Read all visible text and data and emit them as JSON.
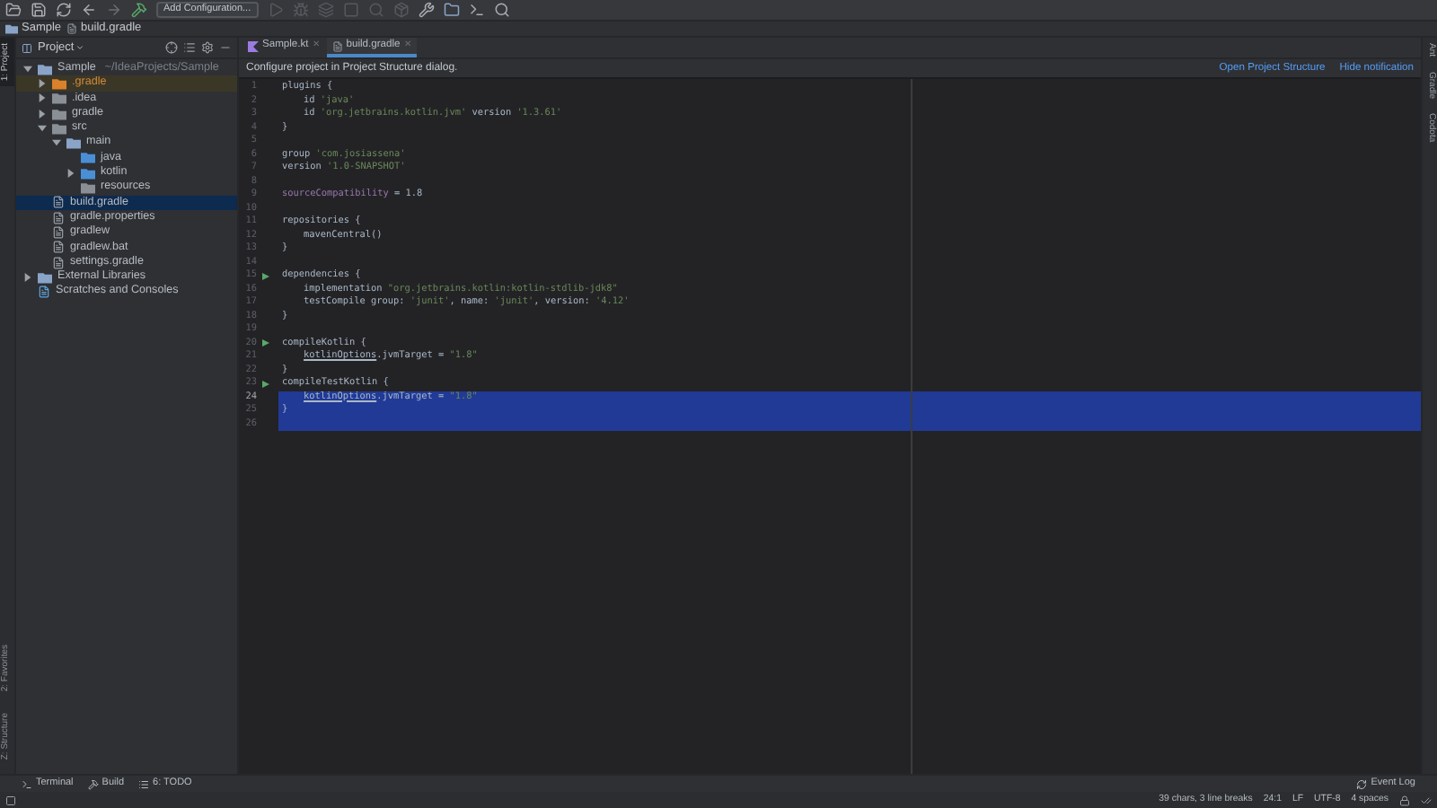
{
  "toolbar": {
    "configuration": "Add Configuration..."
  },
  "breadcrumb": [
    "Sample",
    "build.gradle"
  ],
  "left_stripe": {
    "top": [
      {
        "label": "1: Project",
        "selected": true
      }
    ],
    "bottom": [
      {
        "label": "2: Favorites",
        "selected": false
      },
      {
        "label": "Z: Structure",
        "selected": false
      }
    ]
  },
  "project_panel": {
    "title": "Project",
    "tree": [
      {
        "label": "Sample",
        "hint": "~/IdeaProjects/Sample",
        "kind": "module",
        "expanded": true,
        "selected": false,
        "children": [
          {
            "label": ".gradle",
            "kind": "excluded",
            "expanded": false,
            "selected": false
          },
          {
            "label": ".idea",
            "kind": "folder",
            "expanded": false,
            "selected": false
          },
          {
            "label": "gradle",
            "kind": "folder",
            "expanded": false,
            "selected": false
          },
          {
            "label": "src",
            "kind": "folder",
            "expanded": true,
            "selected": false,
            "children": [
              {
                "label": "main",
                "kind": "module",
                "expanded": true,
                "selected": false,
                "children": [
                  {
                    "label": "java",
                    "kind": "source",
                    "selected": false
                  },
                  {
                    "label": "kotlin",
                    "kind": "source",
                    "expanded": false,
                    "selected": false
                  },
                  {
                    "label": "resources",
                    "kind": "resources",
                    "selected": false
                  }
                ]
              }
            ]
          },
          {
            "label": "build.gradle",
            "kind": "gradle",
            "selected": true
          },
          {
            "label": "gradle.properties",
            "kind": "properties",
            "selected": false
          },
          {
            "label": "gradlew",
            "kind": "file",
            "selected": false
          },
          {
            "label": "gradlew.bat",
            "kind": "file",
            "selected": false
          },
          {
            "label": "settings.gradle",
            "kind": "gradle",
            "selected": false
          }
        ]
      },
      {
        "label": "External Libraries",
        "kind": "library",
        "expanded": false,
        "selected": false
      },
      {
        "label": "Scratches and Consoles",
        "kind": "scratch",
        "selected": false
      }
    ]
  },
  "tabs": [
    {
      "label": "Sample.kt",
      "kind": "kotlin",
      "selected": false,
      "close": "✕"
    },
    {
      "label": "build.gradle",
      "kind": "gradle",
      "selected": true,
      "close": "✕"
    }
  ],
  "notification": {
    "text": "Configure project in Project Structure dialog.",
    "links": [
      "Open Project Structure",
      "Hide notification"
    ]
  },
  "code_lines": [
    {
      "number": "1",
      "run": false,
      "selected": false,
      "tokens": [
        {
          "t": "plugins {",
          "kind": "plain"
        }
      ]
    },
    {
      "number": "2",
      "run": false,
      "selected": false,
      "indented": true,
      "tokens": [
        {
          "t": "id ",
          "kind": "plain"
        },
        {
          "t": "'java'",
          "kind": "string"
        }
      ]
    },
    {
      "number": "3",
      "run": false,
      "selected": false,
      "indented": true,
      "tokens": [
        {
          "t": "id ",
          "kind": "plain"
        },
        {
          "t": "'org.jetbrains.kotlin.jvm'",
          "kind": "string"
        },
        {
          "t": " version ",
          "kind": "plain"
        },
        {
          "t": "'1.3.61'",
          "kind": "string"
        }
      ]
    },
    {
      "number": "4",
      "run": false,
      "selected": false,
      "tokens": [
        {
          "t": "}",
          "kind": "plain"
        }
      ]
    },
    {
      "number": "5",
      "run": false,
      "selected": false
    },
    {
      "number": "6",
      "run": false,
      "selected": false,
      "tokens": [
        {
          "t": "group ",
          "kind": "plain"
        },
        {
          "t": "'com.josiassena'",
          "kind": "string"
        }
      ]
    },
    {
      "number": "7",
      "run": false,
      "selected": false,
      "tokens": [
        {
          "t": "version ",
          "kind": "plain"
        },
        {
          "t": "'1.0-SNAPSHOT'",
          "kind": "string"
        }
      ]
    },
    {
      "number": "8",
      "run": false,
      "selected": false
    },
    {
      "number": "9",
      "run": false,
      "selected": false,
      "tokens": [
        {
          "t": "sourceCompatibility",
          "kind": "property"
        },
        {
          "t": " = 1.8",
          "kind": "plain"
        }
      ]
    },
    {
      "number": "10",
      "run": false,
      "selected": false
    },
    {
      "number": "11",
      "run": false,
      "selected": false,
      "tokens": [
        {
          "t": "repositories {",
          "kind": "plain"
        }
      ]
    },
    {
      "number": "12",
      "run": false,
      "selected": false,
      "indented": true,
      "tokens": [
        {
          "t": "mavenCentral()",
          "kind": "plain"
        }
      ]
    },
    {
      "number": "13",
      "run": false,
      "selected": false,
      "tokens": [
        {
          "t": "}",
          "kind": "plain"
        }
      ]
    },
    {
      "number": "14",
      "run": false,
      "selected": false
    },
    {
      "number": "15",
      "run": true,
      "selected": false,
      "tokens": [
        {
          "t": "dependencies {",
          "kind": "plain"
        }
      ]
    },
    {
      "number": "16",
      "run": false,
      "selected": false,
      "indented": true,
      "tokens": [
        {
          "t": "implementation ",
          "kind": "plain"
        },
        {
          "t": "\"org.jetbrains.kotlin:kotlin-stdlib-jdk8\"",
          "kind": "string"
        }
      ]
    },
    {
      "number": "17",
      "run": false,
      "selected": false,
      "indented": true,
      "tokens": [
        {
          "t": "testCompile group: ",
          "kind": "plain"
        },
        {
          "t": "'junit'",
          "kind": "string"
        },
        {
          "t": ", name: ",
          "kind": "plain"
        },
        {
          "t": "'junit'",
          "kind": "string"
        },
        {
          "t": ", version: ",
          "kind": "plain"
        },
        {
          "t": "'4.12'",
          "kind": "string"
        }
      ]
    },
    {
      "number": "18",
      "run": false,
      "selected": false,
      "tokens": [
        {
          "t": "}",
          "kind": "plain"
        }
      ]
    },
    {
      "number": "19",
      "run": false,
      "selected": false
    },
    {
      "number": "20",
      "run": true,
      "selected": false,
      "tokens": [
        {
          "t": "compileKotlin {",
          "kind": "plain"
        }
      ]
    },
    {
      "number": "21",
      "run": false,
      "selected": false,
      "indented": true,
      "tokens": [
        {
          "t": "kotlinOptions",
          "kind": "reference"
        },
        {
          "t": ".jvmTarget = ",
          "kind": "plain"
        },
        {
          "t": "\"1.8\"",
          "kind": "string"
        }
      ]
    },
    {
      "number": "22",
      "run": false,
      "selected": false,
      "tokens": [
        {
          "t": "}",
          "kind": "plain"
        }
      ]
    },
    {
      "number": "23",
      "run": true,
      "selected": false,
      "tokens": [
        {
          "t": "compileTestKotlin {",
          "kind": "plain"
        }
      ]
    },
    {
      "number": "24",
      "run": false,
      "selected": true,
      "indented": true,
      "tokens": [
        {
          "t": "kotlinOptions",
          "kind": "reference"
        },
        {
          "t": ".jvmTarget = ",
          "kind": "plain"
        },
        {
          "t": "\"1.8\"",
          "kind": "string"
        }
      ]
    },
    {
      "number": "25",
      "run": false,
      "selected": true,
      "tokens": [
        {
          "t": "}",
          "kind": "plain"
        }
      ]
    },
    {
      "number": "26",
      "run": false,
      "selected": true
    }
  ],
  "right_stripe": [
    "Ant",
    "Gradle",
    "Codota"
  ],
  "tool_tabs": [
    {
      "label": "Terminal",
      "kind": "terminal"
    },
    {
      "label": "Build",
      "kind": "build"
    },
    {
      "label": "6: TODO",
      "kind": "todo"
    }
  ],
  "event_log": "Event Log",
  "status_bar": [
    "39 chars, 3 line breaks",
    "24:1",
    "LF",
    "UTF-8",
    "4 spaces"
  ]
}
